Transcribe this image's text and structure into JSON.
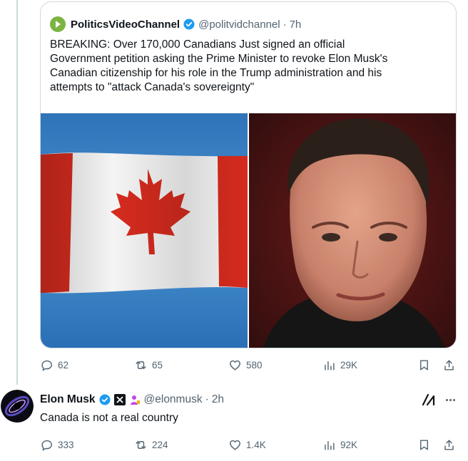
{
  "quoted_post": {
    "author_name": "PoliticsVideoChannel",
    "handle": "@politvidchannel",
    "separator": "·",
    "time": "7h",
    "text": "BREAKING: Over 170,000 Canadians Just signed an official\nGovernment petition asking the Prime Minister to revoke Elon Musk's\nCanadian citizenship for his role in the Trump administration and his\nattempts to \"attack Canada's sovereignty\"",
    "media": [
      "canadian-flag-photo",
      "man-portrait-photo"
    ]
  },
  "main_actions": {
    "replies": "62",
    "reposts": "65",
    "likes": "580",
    "views": "29K"
  },
  "reply": {
    "author_name": "Elon Musk",
    "handle": "@elonmusk",
    "separator": "·",
    "time": "2h",
    "text": "Canada is not a real country",
    "actions": {
      "replies": "333",
      "reposts": "224",
      "likes": "1.4K",
      "views": "92K"
    }
  },
  "colors": {
    "verified_blue": "#1d9bf0",
    "muted_text": "#536471",
    "border": "#cfd9de",
    "flag_red": "#d52b1e",
    "sky_blue": "#3d87c9"
  }
}
